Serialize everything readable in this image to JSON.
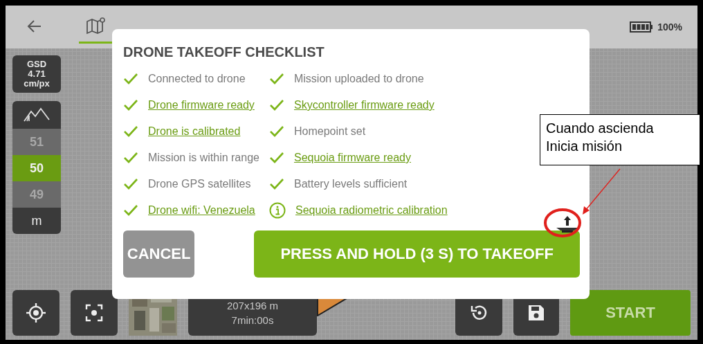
{
  "top_bar": {
    "battery": "100%"
  },
  "gsd": {
    "label": "GSD",
    "value": "4.71",
    "unit": "cm/px"
  },
  "altitude": {
    "values": [
      {
        "label": "51",
        "selected": false
      },
      {
        "label": "50",
        "selected": true
      },
      {
        "label": "49",
        "selected": false
      }
    ],
    "unit": "m"
  },
  "dialog": {
    "title": "DRONE TAKEOFF CHECKLIST",
    "left_items": [
      {
        "label": "Connected to drone",
        "kind": "check",
        "link": false
      },
      {
        "label": "Drone firmware ready",
        "kind": "check",
        "link": true
      },
      {
        "label": "Drone is calibrated",
        "kind": "check",
        "link": true
      },
      {
        "label": "Mission is within range",
        "kind": "check",
        "link": false
      },
      {
        "label": "Drone GPS satellites",
        "kind": "check",
        "link": false
      },
      {
        "label": "Drone wifi: Venezuela",
        "kind": "check",
        "link": true
      }
    ],
    "right_items": [
      {
        "label": "Mission uploaded to drone",
        "kind": "check",
        "link": false
      },
      {
        "label": "Skycontroller firmware ready",
        "kind": "check",
        "link": true
      },
      {
        "label": "Homepoint set",
        "kind": "check",
        "link": false
      },
      {
        "label": "Sequoia firmware ready",
        "kind": "check",
        "link": true
      },
      {
        "label": "Battery levels sufficient",
        "kind": "check",
        "link": false
      },
      {
        "label": "Sequoia radiometric calibration",
        "kind": "info",
        "link": true
      }
    ],
    "cancel": "CANCEL",
    "takeoff": "PRESS AND HOLD (3 S) TO TAKEOFF"
  },
  "bottom_bar": {
    "area": "207x196 m",
    "duration": "7min:00s",
    "start": "START"
  },
  "annotation": {
    "lines": [
      "Cuando ascienda",
      "Inicia misión"
    ]
  }
}
